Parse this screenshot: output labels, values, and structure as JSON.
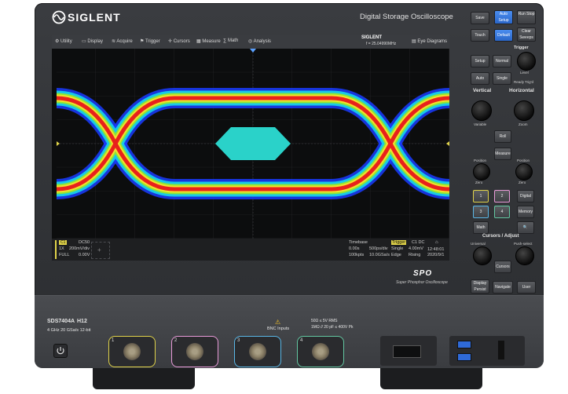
{
  "brand": {
    "name": "SIGLENT",
    "header": "Digital Storage Oscilloscope"
  },
  "menu": [
    "Utility",
    "Display",
    "Acquire",
    "Trigger",
    "Cursors",
    "Measure",
    "Math",
    "Analysis"
  ],
  "screen_header": {
    "brand": "SIGLENT",
    "frequency": "f = 25.04990MHz",
    "eye_tab": "Eye Diagrams"
  },
  "channel_info": {
    "id": "C1",
    "coupling": "DC50",
    "probe": "1X",
    "scale": "200mV/div",
    "bw": "FULL",
    "offset": "0.00V"
  },
  "timebase": {
    "label": "Timebase",
    "delay": "0.00s",
    "scale": "500ps/div",
    "mem": "100kpts",
    "rate": "10.0GSa/s"
  },
  "trigger": {
    "label": "Trigger",
    "source": "C1 DC",
    "mode": "Single",
    "level": "4.00mV",
    "type": "Edge",
    "slope": "Rising"
  },
  "clock": {
    "time": "12:48:01",
    "date": "2020/9/1"
  },
  "sub_brand": {
    "logo": "SPO",
    "tagline": "Super Phosphor Oscilloscope"
  },
  "model": {
    "name": "SDS7404A",
    "option": "H12",
    "spec": "4 GHz  20 GSa/s 12-bit"
  },
  "bnc_info": {
    "label": "BNC Inputs",
    "line1": "50Ω ≤ 5V RMS",
    "line2": "1MΩ // 20 pF ≤ 400V Pk"
  },
  "channels": [
    {
      "n": "1",
      "color": "#e0d34a"
    },
    {
      "n": "2",
      "color": "#e89ad8"
    },
    {
      "n": "3",
      "color": "#5ab7e6"
    },
    {
      "n": "4",
      "color": "#63c7a1"
    }
  ],
  "panel": {
    "save": "Save",
    "auto_setup": "Auto Setup",
    "run_stop": "Run Stop",
    "touch": "Touch",
    "default": "Default",
    "clear_sweeps": "Clear Sweeps",
    "trigger": "Trigger",
    "setup": "Setup",
    "normal": "Normal",
    "auto": "Auto",
    "single": "Single",
    "level": "Level",
    "ready": "Ready",
    "trigd": "Trig'd",
    "vertical": "Vertical",
    "horizontal": "Horizontal",
    "variable": "Variable",
    "zoom": "Zoom",
    "roll": "Roll",
    "measure": "Measure",
    "position": "Position",
    "zero": "Zero",
    "ch1": "1",
    "ch2": "2",
    "digital": "Digital",
    "ch3": "3",
    "ch4": "4",
    "memory": "Memory",
    "math": "Math",
    "search": "🔍",
    "cursors_adjust": "Cursors / Adjust",
    "cursors": "Cursors",
    "push_select": "Push-select",
    "universal": "Universal",
    "display_persist": "Display Persist",
    "navigate": "Navigate",
    "user": "User"
  },
  "colors": {
    "accent": "#3e8ef0",
    "eye_cyan": "#2ad2c9",
    "eye_red": "#e8211c"
  }
}
